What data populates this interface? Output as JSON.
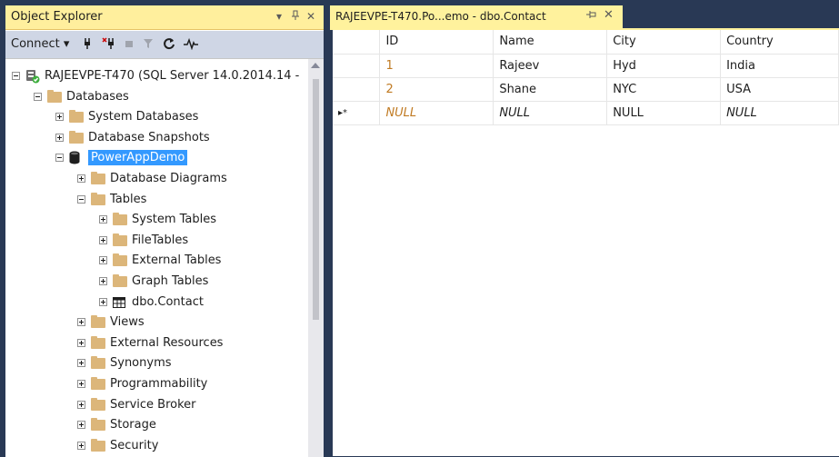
{
  "object_explorer": {
    "title": "Object Explorer",
    "title_controls": {
      "dropdown": "▾",
      "pin": "ꟷ",
      "close": "✕"
    },
    "toolbar": {
      "connect_label": "Connect ▾"
    },
    "tree": [
      {
        "label": "RAJEEVPE-T470 (SQL Server 14.0.2014.14 -",
        "level": 0,
        "expander": "minus",
        "icon": "server-icon"
      },
      {
        "label": "Databases",
        "level": 1,
        "expander": "minus",
        "icon": "folder-icon"
      },
      {
        "label": "System Databases",
        "level": 2,
        "expander": "plus",
        "icon": "folder-icon"
      },
      {
        "label": "Database Snapshots",
        "level": 2,
        "expander": "plus",
        "icon": "folder-icon"
      },
      {
        "label": "PowerAppDemo",
        "level": 2,
        "expander": "minus",
        "icon": "database-icon",
        "selected": true
      },
      {
        "label": "Database Diagrams",
        "level": 3,
        "expander": "plus",
        "icon": "folder-icon"
      },
      {
        "label": "Tables",
        "level": 3,
        "expander": "minus",
        "icon": "folder-icon"
      },
      {
        "label": "System Tables",
        "level": 4,
        "expander": "plus",
        "icon": "folder-icon"
      },
      {
        "label": "FileTables",
        "level": 4,
        "expander": "plus",
        "icon": "folder-icon"
      },
      {
        "label": "External Tables",
        "level": 4,
        "expander": "plus",
        "icon": "folder-icon"
      },
      {
        "label": "Graph Tables",
        "level": 4,
        "expander": "plus",
        "icon": "folder-icon"
      },
      {
        "label": "dbo.Contact",
        "level": 4,
        "expander": "plus",
        "icon": "table-icon"
      },
      {
        "label": "Views",
        "level": 3,
        "expander": "plus",
        "icon": "folder-icon"
      },
      {
        "label": "External Resources",
        "level": 3,
        "expander": "plus",
        "icon": "folder-icon"
      },
      {
        "label": "Synonyms",
        "level": 3,
        "expander": "plus",
        "icon": "folder-icon"
      },
      {
        "label": "Programmability",
        "level": 3,
        "expander": "plus",
        "icon": "folder-icon"
      },
      {
        "label": "Service Broker",
        "level": 3,
        "expander": "plus",
        "icon": "folder-icon"
      },
      {
        "label": "Storage",
        "level": 3,
        "expander": "plus",
        "icon": "folder-icon"
      },
      {
        "label": "Security",
        "level": 3,
        "expander": "plus",
        "icon": "folder-icon"
      }
    ]
  },
  "document": {
    "tab_title": "RAJEEVPE-T470.Po...emo - dbo.Contact",
    "grid": {
      "columns": [
        "ID",
        "Name",
        "City",
        "Country"
      ],
      "rows": [
        {
          "marker": "",
          "ID": "1",
          "Name": "Rajeev",
          "City": "Hyd",
          "Country": "India"
        },
        {
          "marker": "",
          "ID": "2",
          "Name": "Shane",
          "City": "NYC",
          "Country": "USA"
        },
        {
          "marker": "▸*",
          "ID": "NULL",
          "Name": "NULL",
          "City": "NULL",
          "Country": "NULL"
        }
      ]
    }
  },
  "colors": {
    "tab_highlight": "#fff29d",
    "selection": "#3399ff",
    "frame": "#293955",
    "folder": "#dcb67a"
  }
}
